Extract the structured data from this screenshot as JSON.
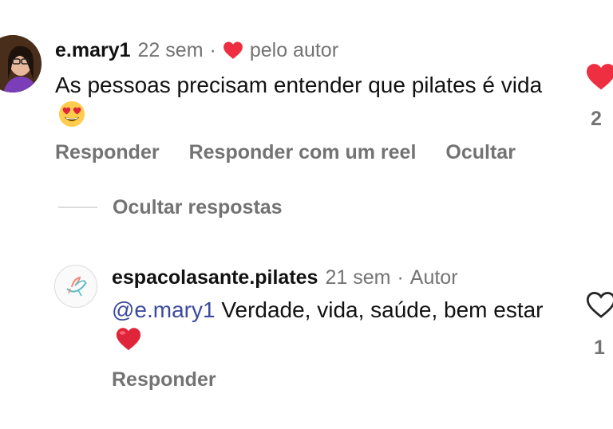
{
  "comment": {
    "username": "e.mary1",
    "time": "22 sem",
    "separator": "·",
    "liked_by_author": "pelo autor",
    "text": "As pessoas precisam entender que pilates é vida",
    "emoji": "heart-eyes-emoji",
    "like_count": "2",
    "liked": true,
    "actions": {
      "reply": "Responder",
      "reply_reel": "Responder com um reel",
      "hide": "Ocultar"
    }
  },
  "hide_replies_label": "Ocultar respostas",
  "reply": {
    "username": "espacolasante.pilates",
    "time": "21 sem",
    "separator": "·",
    "author_badge": "Autor",
    "mention": "@e.mary1",
    "text": "Verdade, vida, saúde, bem estar",
    "emoji": "red-heart-emoji",
    "like_count": "1",
    "liked": false,
    "actions": {
      "reply": "Responder"
    }
  },
  "colors": {
    "primary_text": "#111111",
    "muted_text": "#737373",
    "like_red": "#ed2f41",
    "mention_blue": "#3d4a9e",
    "logo_teal": "#5bbcc2",
    "logo_coral": "#ef8b7c"
  }
}
